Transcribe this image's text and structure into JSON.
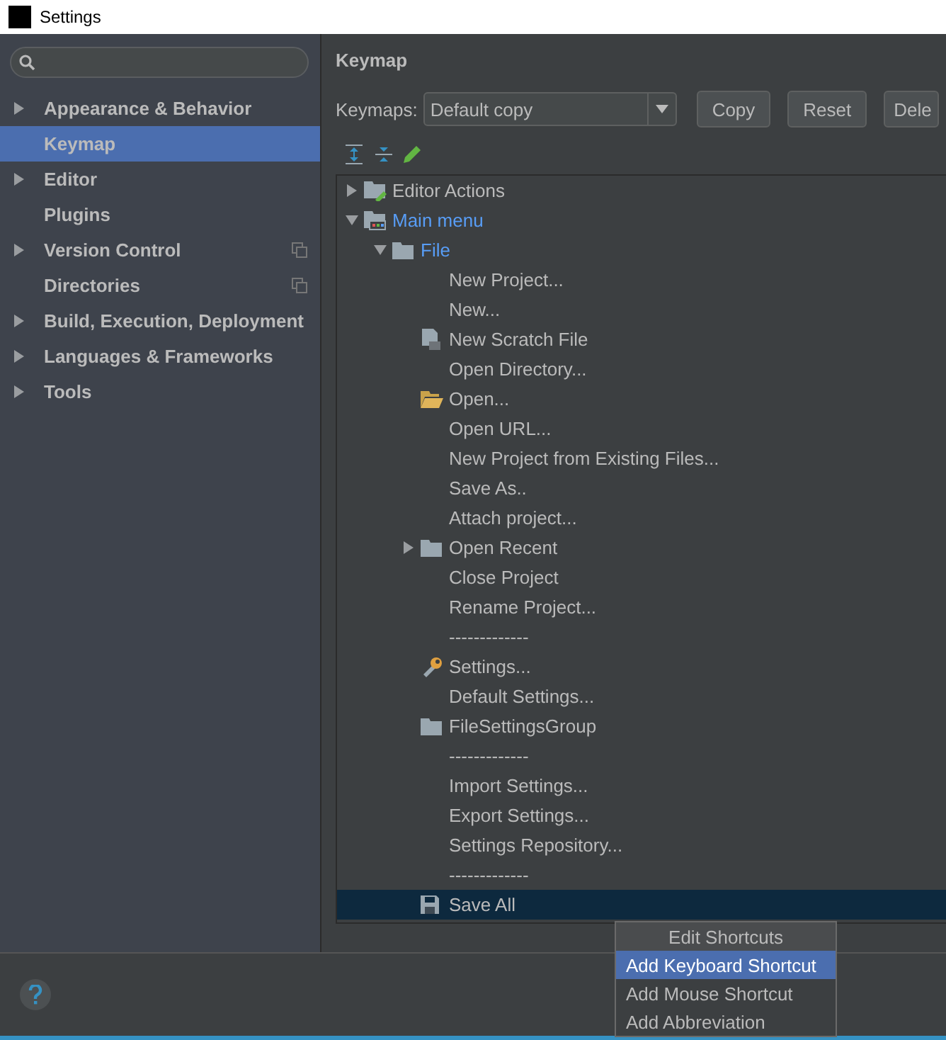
{
  "window": {
    "title": "Settings"
  },
  "sidebar": {
    "items": [
      {
        "label": "Appearance & Behavior",
        "expandable": true,
        "selected": false,
        "per_project": false
      },
      {
        "label": "Keymap",
        "expandable": false,
        "selected": true,
        "per_project": false
      },
      {
        "label": "Editor",
        "expandable": true,
        "selected": false,
        "per_project": false
      },
      {
        "label": "Plugins",
        "expandable": false,
        "selected": false,
        "per_project": false
      },
      {
        "label": "Version Control",
        "expandable": true,
        "selected": false,
        "per_project": true
      },
      {
        "label": "Directories",
        "expandable": false,
        "selected": false,
        "per_project": true
      },
      {
        "label": "Build, Execution, Deployment",
        "expandable": true,
        "selected": false,
        "per_project": false
      },
      {
        "label": "Languages & Frameworks",
        "expandable": true,
        "selected": false,
        "per_project": false
      },
      {
        "label": "Tools",
        "expandable": true,
        "selected": false,
        "per_project": false
      }
    ]
  },
  "panel": {
    "title": "Keymap",
    "keymaps_label": "Keymaps:",
    "keymap_value": "Default copy",
    "buttons": [
      "Copy",
      "Reset",
      "Dele"
    ]
  },
  "tree": [
    {
      "label": "Editor Actions",
      "kind": "edit-folder",
      "expanded": false,
      "modified": false,
      "selected": false
    },
    {
      "label": "Main menu",
      "kind": "menu-folder",
      "expanded": true,
      "modified": true,
      "selected": false,
      "children": [
        {
          "label": "File",
          "kind": "folder",
          "expanded": true,
          "modified": true,
          "selected": false,
          "children": [
            {
              "label": "New Project...",
              "kind": "action",
              "modified": false,
              "selected": false
            },
            {
              "label": "New...",
              "kind": "action",
              "modified": false,
              "selected": false
            },
            {
              "label": "New Scratch File",
              "kind": "scratch",
              "modified": false,
              "selected": false
            },
            {
              "label": "Open Directory...",
              "kind": "action",
              "modified": false,
              "selected": false
            },
            {
              "label": "Open...",
              "kind": "open",
              "modified": false,
              "selected": false
            },
            {
              "label": "Open URL...",
              "kind": "action",
              "modified": false,
              "selected": false
            },
            {
              "label": "New Project from Existing Files...",
              "kind": "action",
              "modified": false,
              "selected": false
            },
            {
              "label": "Save As..",
              "kind": "action",
              "modified": false,
              "selected": false
            },
            {
              "label": "Attach project...",
              "kind": "action",
              "modified": false,
              "selected": false
            },
            {
              "label": "Open Recent",
              "kind": "folder",
              "expanded": false,
              "modified": false,
              "selected": false
            },
            {
              "label": "Close Project",
              "kind": "action",
              "modified": false,
              "selected": false
            },
            {
              "label": "Rename Project...",
              "kind": "action",
              "modified": false,
              "selected": false
            },
            {
              "label": "-------------",
              "kind": "action",
              "modified": false,
              "selected": false
            },
            {
              "label": "Settings...",
              "kind": "settings",
              "modified": false,
              "selected": false
            },
            {
              "label": "Default Settings...",
              "kind": "action",
              "modified": false,
              "selected": false
            },
            {
              "label": "FileSettingsGroup",
              "kind": "folder",
              "modified": false,
              "selected": false
            },
            {
              "label": "-------------",
              "kind": "action",
              "modified": false,
              "selected": false
            },
            {
              "label": "Import Settings...",
              "kind": "action",
              "modified": false,
              "selected": false
            },
            {
              "label": "Export Settings...",
              "kind": "action",
              "modified": false,
              "selected": false
            },
            {
              "label": "Settings Repository...",
              "kind": "action",
              "modified": false,
              "selected": false
            },
            {
              "label": "-------------",
              "kind": "action",
              "modified": false,
              "selected": false
            },
            {
              "label": "Save All",
              "kind": "save",
              "modified": false,
              "selected": true
            }
          ]
        }
      ]
    }
  ],
  "context_menu": {
    "title": "Edit Shortcuts",
    "items": [
      {
        "label": "Add Keyboard Shortcut",
        "selected": true
      },
      {
        "label": "Add Mouse Shortcut",
        "selected": false
      },
      {
        "label": "Add Abbreviation",
        "selected": false
      }
    ]
  }
}
